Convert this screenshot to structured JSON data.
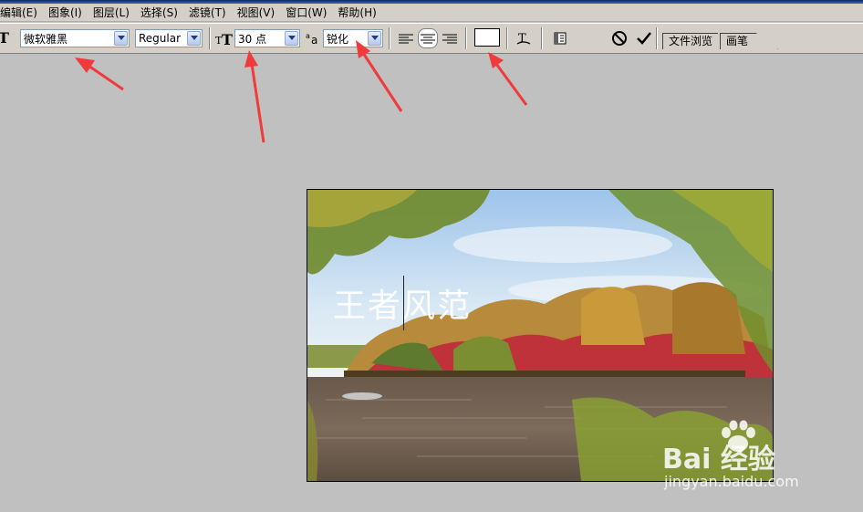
{
  "menu": {
    "items": [
      {
        "label": "编辑(E)"
      },
      {
        "label": "图象(I)"
      },
      {
        "label": "图层(L)"
      },
      {
        "label": "选择(S)"
      },
      {
        "label": "滤镜(T)"
      },
      {
        "label": "视图(V)"
      },
      {
        "label": "窗口(W)"
      },
      {
        "label": "帮助(H)"
      }
    ]
  },
  "options": {
    "tool_icon": "T",
    "font_family": "微软雅黑",
    "font_style": "Regular",
    "font_size": "30 点",
    "anti_alias": "锐化",
    "panel_tabs": [
      "文件浏览",
      "画笔"
    ]
  },
  "canvas": {
    "text": "王者风范"
  },
  "watermark": {
    "logo": "Bai 经验",
    "url": "jingyan.baidu.com"
  },
  "colors": {
    "background": "#c0c0c0",
    "toolbar": "#d4d0c8",
    "arrow": "#ef3b3b",
    "text_color_swatch": "#ffffff"
  },
  "icons": {
    "text_tool": "text-tool-icon",
    "font_size": "font-size-icon",
    "anti_alias": "anti-alias-icon",
    "align_left": "align-left-icon",
    "align_center": "align-center-icon",
    "align_right": "align-right-icon",
    "warp": "warp-text-icon",
    "palettes": "palettes-icon",
    "cancel": "cancel-icon",
    "commit": "commit-checkmark-icon"
  }
}
